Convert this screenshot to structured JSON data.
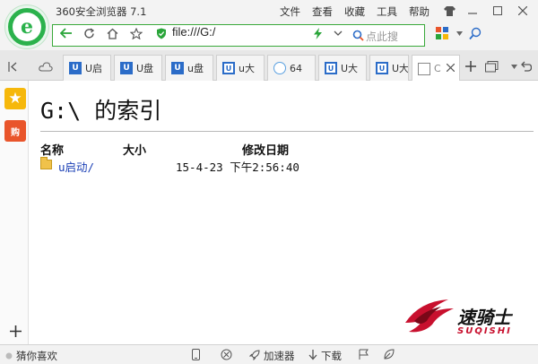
{
  "window": {
    "title": "360安全浏览器 7.1",
    "menu": [
      "文件",
      "查看",
      "收藏",
      "工具",
      "帮助"
    ]
  },
  "address_bar": {
    "url": "file:///G:/",
    "search_placeholder": "点此搜"
  },
  "tabs": [
    {
      "label": "U启",
      "icon": "u-logo-icon"
    },
    {
      "label": "U盘",
      "icon": "u-logo-icon"
    },
    {
      "label": "u盘",
      "icon": "u-logo-icon"
    },
    {
      "label": "u大",
      "icon": "u-frame-icon"
    },
    {
      "label": "64",
      "icon": "cloud-icon"
    },
    {
      "label": "U大",
      "icon": "u-frame-icon"
    },
    {
      "label": "U大",
      "icon": "u-frame-icon"
    },
    {
      "label": "C",
      "icon": "document-icon",
      "active": true
    }
  ],
  "sidebar": {
    "shopping_label": "购"
  },
  "content": {
    "title": "G:\\ 的索引",
    "columns": {
      "name": "名称",
      "size": "大小",
      "modified": "修改日期"
    },
    "rows": [
      {
        "name": "u启动/",
        "size": "",
        "modified": "15-4-23 下午2:56:40"
      }
    ]
  },
  "watermark": {
    "text": "速骑士",
    "sub": "SUQISHI"
  },
  "statusbar": {
    "guess_label": "猜你喜欢",
    "accelerator_label": "加速器",
    "download_label": "下载"
  }
}
